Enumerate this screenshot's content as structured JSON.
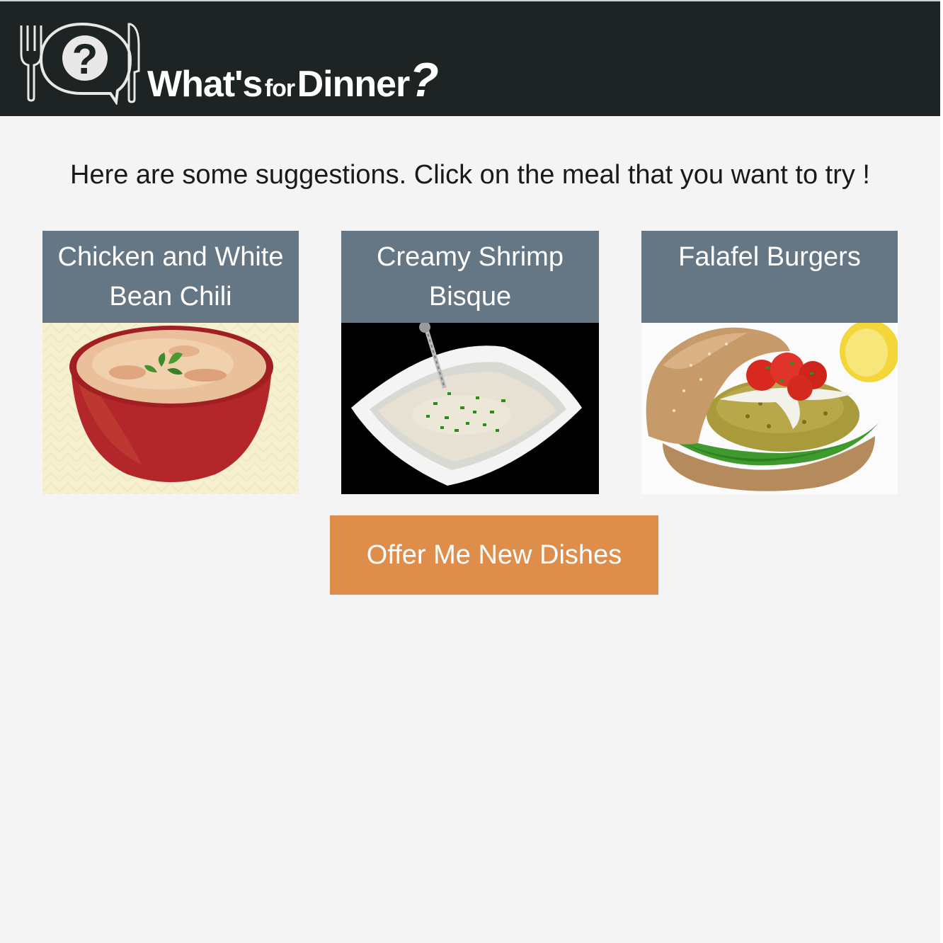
{
  "header": {
    "logo_text_main": "What's",
    "logo_text_small": "for",
    "logo_text_end": "Dinner",
    "logo_text_mark": "?",
    "logo_icons": [
      "fork-icon",
      "question-bubble-icon",
      "knife-icon"
    ]
  },
  "main": {
    "prompt": "Here are some suggestions. Click on the meal that you want to try !"
  },
  "meals": [
    {
      "title": "Chicken and White Bean Chili",
      "image": "chili-bowl-photo"
    },
    {
      "title": "Creamy Shrimp Bisque",
      "image": "shrimp-bisque-photo"
    },
    {
      "title": "Falafel Burgers",
      "image": "falafel-burger-photo"
    }
  ],
  "actions": {
    "offer_label": "Offer Me New Dishes"
  },
  "colors": {
    "header_bg": "#1e2324",
    "page_bg": "#f3f4f3",
    "card_title_bg": "#657684",
    "button_bg": "#de8d4b"
  }
}
